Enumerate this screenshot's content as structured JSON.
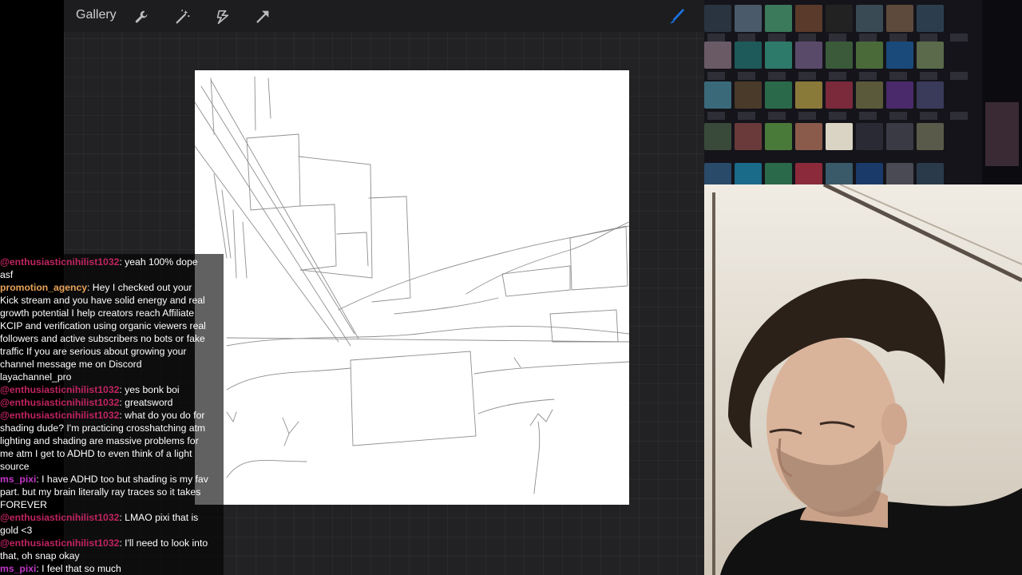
{
  "toolbar": {
    "gallery_label": "Gallery",
    "tools": [
      {
        "name": "wrench-icon"
      },
      {
        "name": "magic-wand-icon"
      },
      {
        "name": "selection-icon"
      },
      {
        "name": "transform-arrow-icon"
      },
      {
        "name": "brush-icon",
        "color": "#1a74e0"
      }
    ]
  },
  "chat": {
    "colors": {
      "enthusiasticnihilist1032": "#c0245f",
      "promotion_agency": "#e8a25a",
      "ms_pixi": "#c238c8"
    },
    "messages": [
      {
        "user": "@enthusiasticnihilist1032",
        "text": ": yeah 100% dope asf"
      },
      {
        "user": "promotion_agency",
        "text": ": Hey I checked out your Kick stream and you have solid energy and real growth potential I help creators reach Affiliate KCIP and verification using organic viewers real followers and active subscribers no bots or fake traffic If you are serious about growing your channel message me on Discord layachannel_pro"
      },
      {
        "user": "@enthusiasticnihilist1032",
        "text": ": yes bonk boi"
      },
      {
        "user": "@enthusiasticnihilist1032",
        "text": ": greatsword"
      },
      {
        "user": "@enthusiasticnihilist1032",
        "text": ": what do you do for shading dude? I'm practicing crosshatching atm lighting and shading are massive problems for me atm I get to ADHD to even think of a light source"
      },
      {
        "user": "ms_pixi",
        "text": ": I have ADHD too but shading is my fav part. but my brain literally ray traces so it takes FOREVER"
      },
      {
        "user": "@enthusiasticnihilist1032",
        "text": ": LMAO pixi that is gold <3"
      },
      {
        "user": "@enthusiasticnihilist1032",
        "text": ": I'll need to look into that, oh snap okay"
      },
      {
        "user": "ms_pixi",
        "text": ": I feel that so much"
      }
    ]
  }
}
